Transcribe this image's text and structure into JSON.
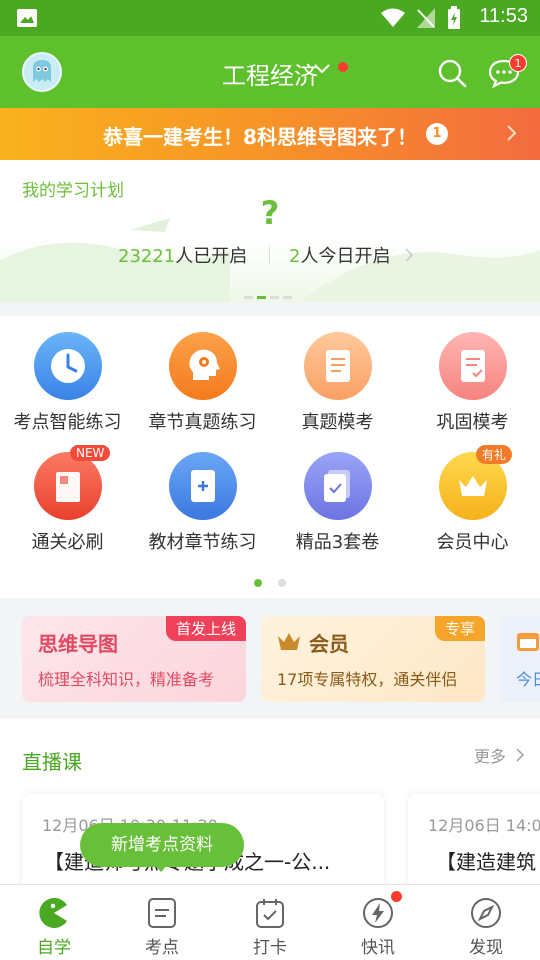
{
  "status_bar": {
    "time": "11:53"
  },
  "header": {
    "title": "工程经济",
    "message_badge": "1"
  },
  "banner": {
    "text": "恭喜一建考生！8科思维导图来了！",
    "number": "1"
  },
  "study_plan": {
    "label": "我的学习计划",
    "mark": "?",
    "opened_count": "23221",
    "opened_text": "人已开启",
    "today_count": "2",
    "today_text": "人今日开启"
  },
  "grid": {
    "items": [
      {
        "label": "考点智能练习",
        "icon": "clock-icon"
      },
      {
        "label": "章节真题练习",
        "icon": "gear-head-icon"
      },
      {
        "label": "真题模考",
        "icon": "document-icon"
      },
      {
        "label": "巩固模考",
        "icon": "checklist-icon"
      },
      {
        "label": "通关必刷",
        "icon": "book-icon",
        "tag": "NEW"
      },
      {
        "label": "教材章节练习",
        "icon": "textbook-icon"
      },
      {
        "label": "精品3套卷",
        "icon": "papers-icon"
      },
      {
        "label": "会员中心",
        "icon": "crown-icon",
        "tag": "有礼"
      }
    ]
  },
  "promos": [
    {
      "title": "思维导图",
      "subtitle": "梳理全科知识，精准备考",
      "tag": "首发上线"
    },
    {
      "title": "会员",
      "subtitle": "17项专属特权，通关伴侣",
      "tag": "专享"
    },
    {
      "subtitle": "今日"
    }
  ],
  "live": {
    "heading": "直播课",
    "more": "更多",
    "cards": [
      {
        "date": "12月06日 10:30-11:30",
        "title": "【建造师考点专题小成之一-公..."
      },
      {
        "date": "12月06日 14:0",
        "title": "【建造建筑"
      }
    ]
  },
  "toast": "新增考点资料",
  "nav": {
    "items": [
      {
        "label": "自学",
        "icon": "pacman-icon",
        "active": true
      },
      {
        "label": "考点",
        "icon": "notes-icon",
        "active": false
      },
      {
        "label": "打卡",
        "icon": "calendar-check-icon",
        "active": false
      },
      {
        "label": "快讯",
        "icon": "lightning-icon",
        "active": false
      },
      {
        "label": "发现",
        "icon": "compass-icon",
        "active": false
      }
    ]
  },
  "colors": {
    "brand_green": "#5fc02e",
    "banner_orange": "#f79327",
    "badge_red": "#ff3b30"
  }
}
